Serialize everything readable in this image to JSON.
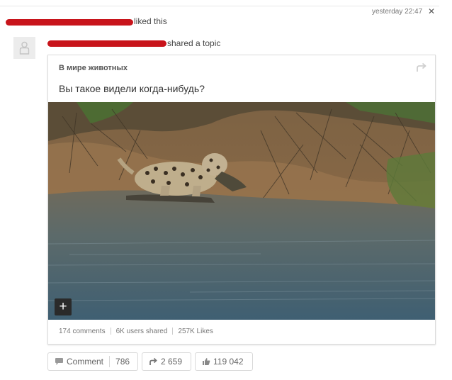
{
  "header": {
    "liked_text": "liked this",
    "timestamp": "yesterday 22:47",
    "close": "✕",
    "shared_text": "shared a topic"
  },
  "post": {
    "group_name": "В мире животных",
    "title": "Вы такое видели когда-нибудь?",
    "expand_button": "+",
    "stats": {
      "comments": "174 comments",
      "shared": "6K users shared",
      "likes": "257K Likes"
    }
  },
  "actions": {
    "comment_label": "Comment",
    "comment_count": "786",
    "share_count": "2 659",
    "like_count": "119 042"
  },
  "colors": {
    "redaction": "#c8141b",
    "border": "#dcdcdc"
  }
}
